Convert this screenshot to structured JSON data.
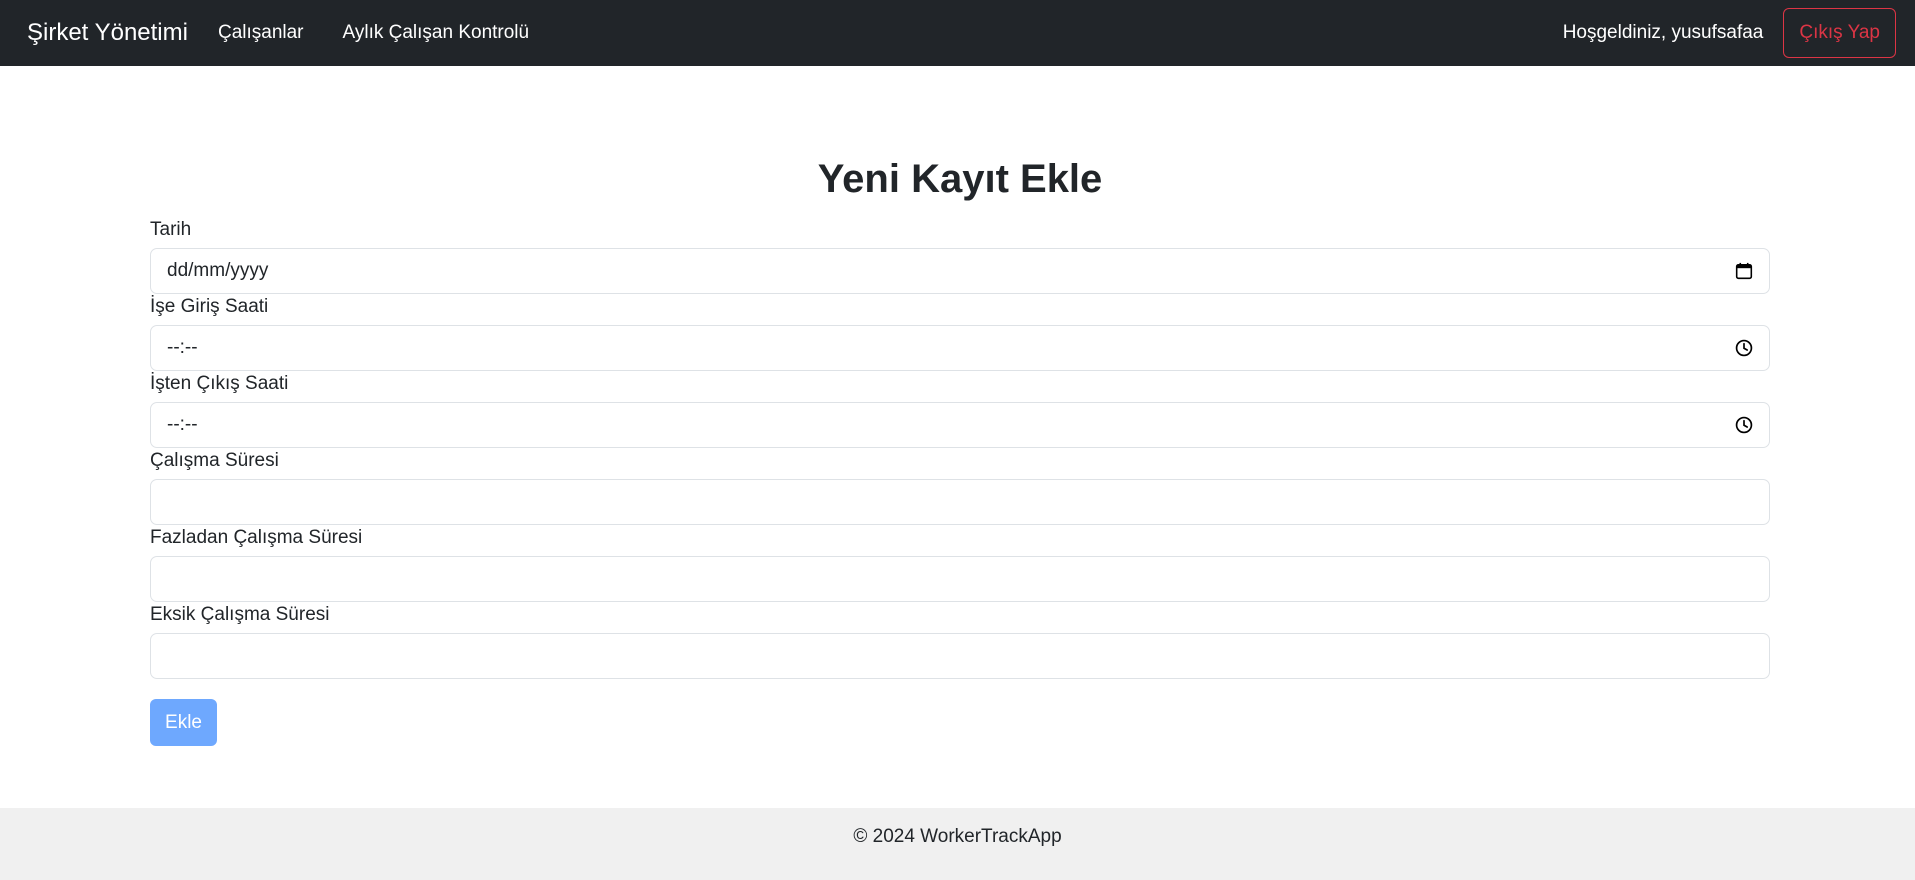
{
  "navbar": {
    "brand": "Şirket Yönetimi",
    "links": [
      "Çalışanlar",
      "Aylık Çalışan Kontrolü"
    ],
    "welcome": "Hoşgeldiniz, yusufsafaa",
    "logout_label": "Çıkış Yap"
  },
  "main": {
    "title": "Yeni Kayıt Ekle",
    "fields": [
      {
        "label": "Tarih",
        "value": "dd/mm/yyyy",
        "icon": "calendar-icon"
      },
      {
        "label": "İşe Giriş Saati",
        "value": "--:--",
        "icon": "clock-icon"
      },
      {
        "label": "İşten Çıkış Saati",
        "value": "--:--",
        "icon": "clock-icon"
      },
      {
        "label": "Çalışma Süresi",
        "value": ""
      },
      {
        "label": "Fazladan Çalışma Süresi",
        "value": ""
      },
      {
        "label": "Eksik Çalışma Süresi",
        "value": ""
      }
    ],
    "submit_label": "Ekle"
  },
  "footer": {
    "text": "© 2024 WorkerTrackApp"
  },
  "colors": {
    "navbar_bg": "#212529",
    "danger": "#dc3545",
    "primary_light": "#6ea8fe",
    "footer_bg": "#f0f0f0"
  }
}
